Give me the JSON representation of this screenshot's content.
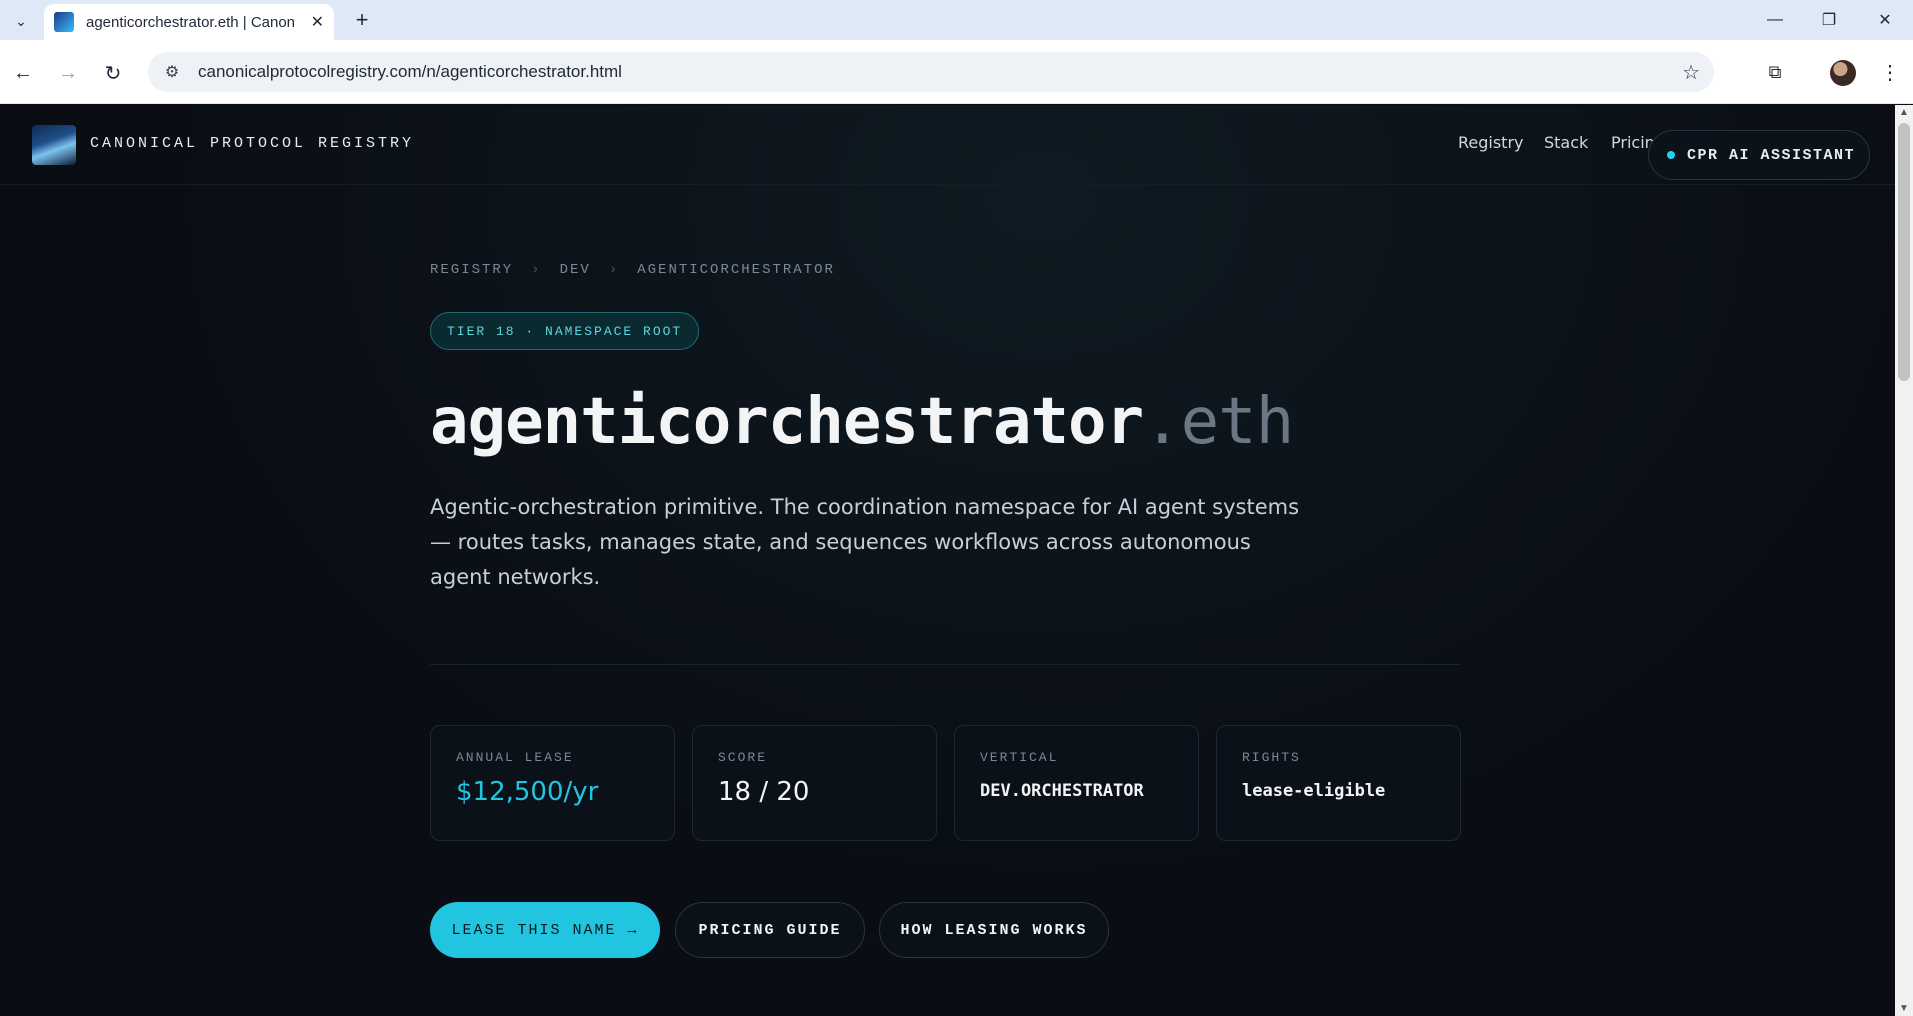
{
  "browser": {
    "tab_title": "agenticorchestrator.eth | Canonical Protocol Registry",
    "url": "canonicalprotocolregistry.com/n/agenticorchestrator.html"
  },
  "header": {
    "brand": "CANONICAL PROTOCOL REGISTRY",
    "nav": [
      "Registry",
      "Stack",
      "Pricing"
    ],
    "assistant_label": "CPR AI ASSISTANT"
  },
  "breadcrumb": [
    "REGISTRY",
    "DEV",
    "AGENTICORCHESTRATOR"
  ],
  "breadcrumb_sep": "›",
  "tier_badge": "TIER 18 · NAMESPACE ROOT",
  "name": {
    "label": "agenticorchestrator",
    "tld": ".eth"
  },
  "description": "Agentic-orchestration primitive. The coordination namespace for AI agent systems — routes tasks, manages state, and sequences workflows across autonomous agent networks.",
  "stats": [
    {
      "label": "ANNUAL LEASE",
      "value": "$12,500/yr"
    },
    {
      "label": "SCORE",
      "value": "18 / 20"
    },
    {
      "label": "VERTICAL",
      "value": "DEV.ORCHESTRATOR"
    },
    {
      "label": "RIGHTS",
      "value": "lease-eligible"
    }
  ],
  "actions": {
    "lease": "LEASE THIS NAME →",
    "pricing": "PRICING GUIDE",
    "how": "HOW LEASING WORKS"
  },
  "colors": {
    "accent": "#22c5df",
    "background": "#0a0e14"
  }
}
